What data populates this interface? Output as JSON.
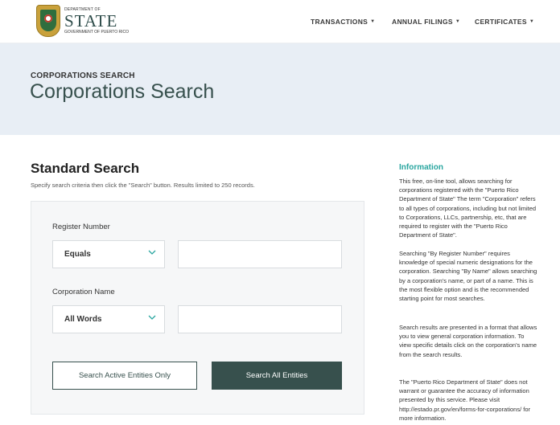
{
  "header": {
    "logo": {
      "line1": "DEPARTMENT OF",
      "line2": "STATE",
      "line3": "GOVERNMENT OF PUERTO RICO"
    },
    "nav": [
      {
        "label": "TRANSACTIONS"
      },
      {
        "label": "ANNUAL FILINGS"
      },
      {
        "label": "CERTIFICATES"
      }
    ]
  },
  "banner": {
    "eyebrow": "CORPORATIONS SEARCH",
    "title": "Corporations Search"
  },
  "search": {
    "title": "Standard Search",
    "subtitle": "Specify search criteria then click the \"Search\" button. Results limited to 250 records.",
    "register_number": {
      "label": "Register Number",
      "operator": "Equals",
      "value": ""
    },
    "corporation_name": {
      "label": "Corporation Name",
      "operator": "All Words",
      "value": ""
    },
    "active_button": "Search Active Entities Only",
    "all_button": "Search All Entities"
  },
  "info": {
    "title": "Information",
    "paragraphs": [
      "This free, on-line tool, allows searching for corporations registered with the \"Puerto Rico Department of State\" The term \"Corporation\" refers to all types of corporations, including but not limited to Corporations, LLCs, partnership, etc, that are required to register with the \"Puerto Rico Department of State\".",
      "Searching \"By Register Number\" requires knowledge of special numeric designations for the corporation. Searching \"By Name\" allows searching by a corporation's name, or part of a name. This is the most flexible option and is the recommended starting point for most searches.",
      "Search results are presented in a format that allows you to view general corporation information. To view specific details click on the corporation's name from the search results.",
      "The \"Puerto Rico Department of State\" does not warrant or guarantee the accuracy of information presented by this service. Please visit http://estado.pr.gov/en/forms-for-corporations/ for more information."
    ]
  },
  "colors": {
    "accent": "#37504d",
    "info_title": "#2aa6a0",
    "banner_bg": "#e8eef5",
    "chevron": "#2aa6a0"
  },
  "icons": {
    "logo": "puerto-rico-seal-icon",
    "nav_caret": "caret-down-icon",
    "select_chevron": "chevron-down-icon"
  }
}
